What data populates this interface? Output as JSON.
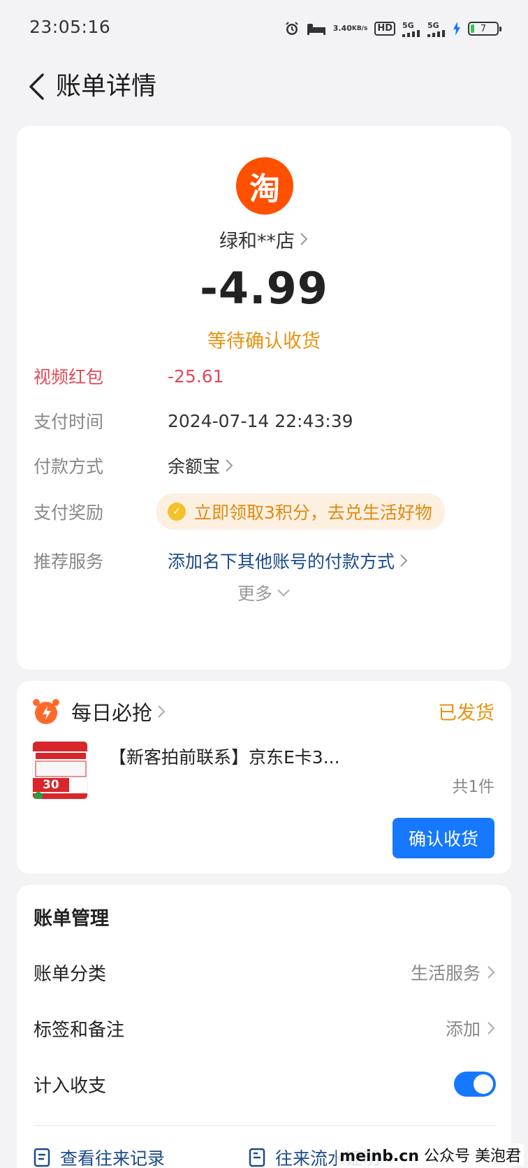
{
  "status_bar": {
    "time": "23:05:16",
    "net_speed_value": "3.40",
    "net_speed_unit": "KB/s",
    "hd_label": "HD",
    "signal1_label": "5G",
    "signal2_label": "5G",
    "battery_level": "7"
  },
  "header": {
    "title": "账单详情"
  },
  "bill": {
    "logo_char": "淘",
    "merchant": "绿和**店",
    "amount": "-4.99",
    "status": "等待确认收货",
    "details": [
      {
        "label": "视频红包",
        "value": "-25.61"
      },
      {
        "label": "支付时间",
        "value": "2024-07-14 22:43:39"
      },
      {
        "label": "付款方式",
        "value": "余额宝"
      },
      {
        "label": "支付奖励",
        "value": "立即领取3积分，去兑生活好物"
      },
      {
        "label": "推荐服务",
        "value": "添加名下其他账号的付款方式"
      }
    ],
    "more_label": "更多"
  },
  "deal": {
    "title": "每日必抢",
    "ship_status": "已发货",
    "product_name": "【新客拍前联系】京东E卡3...",
    "item_count": "共1件",
    "confirm_label": "确认收货",
    "thumb_price": "30"
  },
  "management": {
    "title": "账单管理",
    "rows": [
      {
        "label": "账单分类",
        "value": "生活服务"
      },
      {
        "label": "标签和备注",
        "value": "添加"
      },
      {
        "label": "计入收支",
        "value": ""
      }
    ],
    "toggle_on": true,
    "links": [
      {
        "label": "查看往来记录"
      },
      {
        "label": "往来流水证明"
      }
    ]
  },
  "watermark": {
    "site": "meinb.cn",
    "text": "公众号 美泡君"
  },
  "colors": {
    "accent_blue": "#1677ff",
    "status_orange": "#e99210",
    "taobao_orange": "#ff5000",
    "red_packet": "#e04a5a"
  }
}
